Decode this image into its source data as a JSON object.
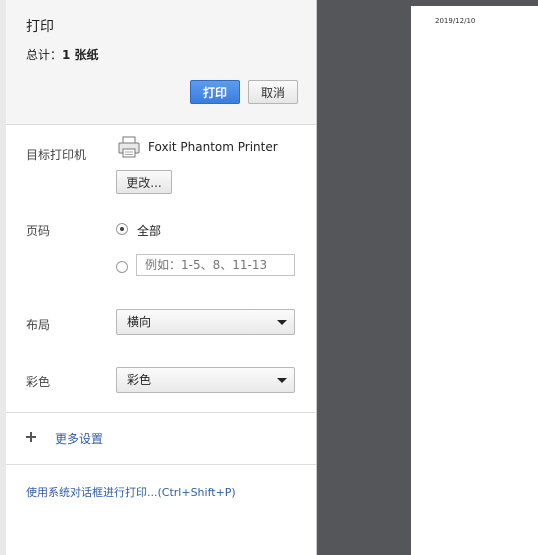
{
  "header": {
    "title": "打印",
    "total_prefix": "总计：",
    "total_value": "1 张纸",
    "print_label": "打印",
    "cancel_label": "取消"
  },
  "destination": {
    "label": "目标打印机",
    "printer_name": "Foxit Phantom Printer",
    "change_label": "更改...",
    "icon": "printer-icon"
  },
  "pages": {
    "label": "页码",
    "all_label": "全部",
    "custom_placeholder": "例如：1-5、8、11-13",
    "selected": "all"
  },
  "layout": {
    "label": "布局",
    "selected": "横向"
  },
  "color": {
    "label": "彩色",
    "selected": "彩色"
  },
  "more_settings": {
    "label": "更多设置",
    "icon": "plus-icon"
  },
  "system_dialog": {
    "label": "使用系统对话框进行打印...(Ctrl+Shift+P)"
  },
  "preview": {
    "date": "2019/12/10"
  },
  "colors": {
    "accent": "#3b7ddd",
    "link": "#2f5da8",
    "preview_bg": "#55565a"
  }
}
